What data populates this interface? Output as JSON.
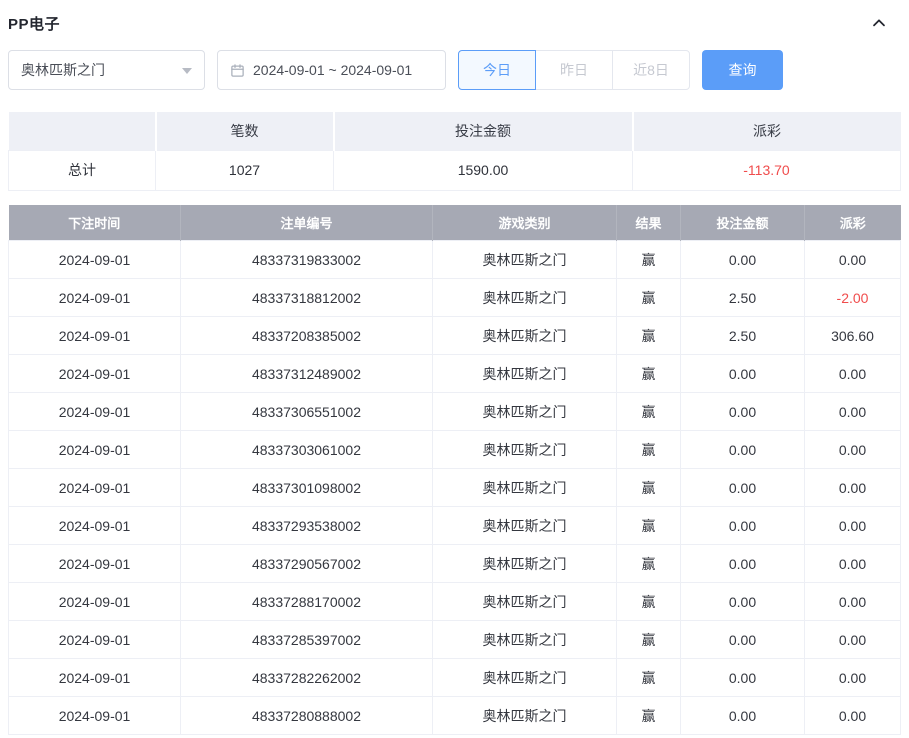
{
  "panel": {
    "title": "PP电子"
  },
  "filters": {
    "game_select": {
      "value": "奥林匹斯之门"
    },
    "date_range": {
      "value": "2024-09-01 ~ 2024-09-01"
    },
    "quick_ranges": {
      "today": "今日",
      "yesterday": "昨日",
      "last8": "近8日"
    },
    "query_button": "查询"
  },
  "summary": {
    "col_count": "笔数",
    "col_bet": "投注金额",
    "col_payout": "派彩",
    "total_label": "总计",
    "total_count": "1027",
    "total_bet": "1590.00",
    "total_payout": "-113.70"
  },
  "table": {
    "headers": [
      "下注时间",
      "注单编号",
      "游戏类别",
      "结果",
      "投注金额",
      "派彩"
    ],
    "rows": [
      [
        "2024-09-01",
        "48337319833002",
        "奥林匹斯之门",
        "赢",
        "0.00",
        "0.00"
      ],
      [
        "2024-09-01",
        "48337318812002",
        "奥林匹斯之门",
        "赢",
        "2.50",
        "-2.00"
      ],
      [
        "2024-09-01",
        "48337208385002",
        "奥林匹斯之门",
        "赢",
        "2.50",
        "306.60"
      ],
      [
        "2024-09-01",
        "48337312489002",
        "奥林匹斯之门",
        "赢",
        "0.00",
        "0.00"
      ],
      [
        "2024-09-01",
        "48337306551002",
        "奥林匹斯之门",
        "赢",
        "0.00",
        "0.00"
      ],
      [
        "2024-09-01",
        "48337303061002",
        "奥林匹斯之门",
        "赢",
        "0.00",
        "0.00"
      ],
      [
        "2024-09-01",
        "48337301098002",
        "奥林匹斯之门",
        "赢",
        "0.00",
        "0.00"
      ],
      [
        "2024-09-01",
        "48337293538002",
        "奥林匹斯之门",
        "赢",
        "0.00",
        "0.00"
      ],
      [
        "2024-09-01",
        "48337290567002",
        "奥林匹斯之门",
        "赢",
        "0.00",
        "0.00"
      ],
      [
        "2024-09-01",
        "48337288170002",
        "奥林匹斯之门",
        "赢",
        "0.00",
        "0.00"
      ],
      [
        "2024-09-01",
        "48337285397002",
        "奥林匹斯之门",
        "赢",
        "0.00",
        "0.00"
      ],
      [
        "2024-09-01",
        "48337282262002",
        "奥林匹斯之门",
        "赢",
        "0.00",
        "0.00"
      ],
      [
        "2024-09-01",
        "48337280888002",
        "奥林匹斯之门",
        "赢",
        "0.00",
        "0.00"
      ]
    ]
  },
  "colors": {
    "accent": "#5b9df8",
    "negative": "#f04c4c",
    "table_header_bg": "#a6a9b4",
    "summary_header_bg": "#eef0f6"
  }
}
